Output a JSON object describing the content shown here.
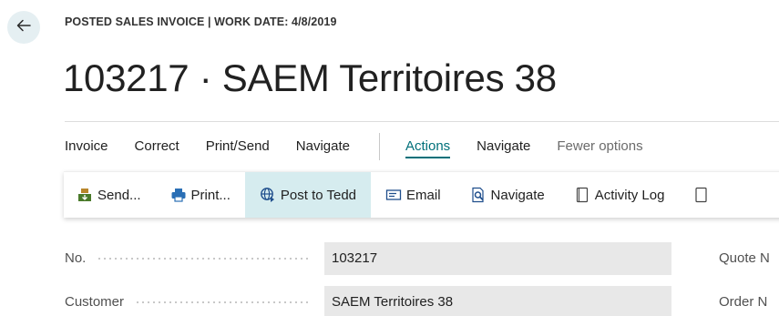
{
  "header": {
    "caption": "POSTED SALES INVOICE | WORK DATE: 4/8/2019",
    "title": "103217 · SAEM Territoires 38"
  },
  "menu": {
    "items": [
      {
        "label": "Invoice"
      },
      {
        "label": "Correct"
      },
      {
        "label": "Print/Send"
      },
      {
        "label": "Navigate"
      }
    ],
    "secondary": [
      {
        "label": "Actions",
        "active": true
      },
      {
        "label": "Navigate"
      },
      {
        "label": "Fewer options"
      }
    ]
  },
  "actions": [
    {
      "label": "Send...",
      "icon": "send-icon"
    },
    {
      "label": "Print...",
      "icon": "printer-icon"
    },
    {
      "label": "Post to Tedd",
      "icon": "globe-icon"
    },
    {
      "label": "Email",
      "icon": "email-icon"
    },
    {
      "label": "Navigate",
      "icon": "navigate-document-icon"
    },
    {
      "label": "Activity Log",
      "icon": "activity-log-icon"
    }
  ],
  "fields": [
    {
      "label": "No.",
      "value": "103217",
      "right_label": "Quote N"
    },
    {
      "label": "Customer",
      "value": "SAEM Territoires 38",
      "right_label": "Order N"
    }
  ],
  "colors": {
    "accent": "#00707a",
    "highlight": "#d6ecef",
    "field_bg": "#e8e8e8",
    "back_button_bg": "#e5eff2"
  }
}
